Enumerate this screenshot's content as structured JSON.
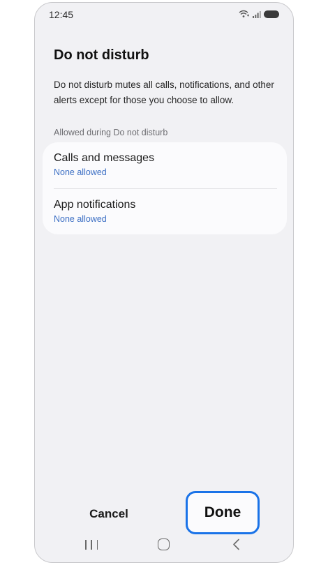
{
  "status_bar": {
    "time": "12:45",
    "icons": [
      "wifi-call-icon",
      "signal-icon",
      "battery-icon"
    ]
  },
  "page": {
    "title": "Do not disturb",
    "description": "Do not disturb mutes all calls, notifications, and other alerts except for those you choose to allow.",
    "section_label": "Allowed during Do not disturb"
  },
  "options": [
    {
      "title": "Calls and messages",
      "subtitle": "None allowed"
    },
    {
      "title": "App notifications",
      "subtitle": "None allowed"
    }
  ],
  "actions": {
    "cancel_label": "Cancel",
    "done_label": "Done"
  },
  "nav_bar": {
    "icons": [
      "recents-icon",
      "home-icon",
      "back-icon"
    ]
  },
  "colors": {
    "accent_link": "#3c6fc4",
    "highlight_border": "#1a73e8",
    "background": "#f1f1f4",
    "card": "#fbfbfd"
  }
}
